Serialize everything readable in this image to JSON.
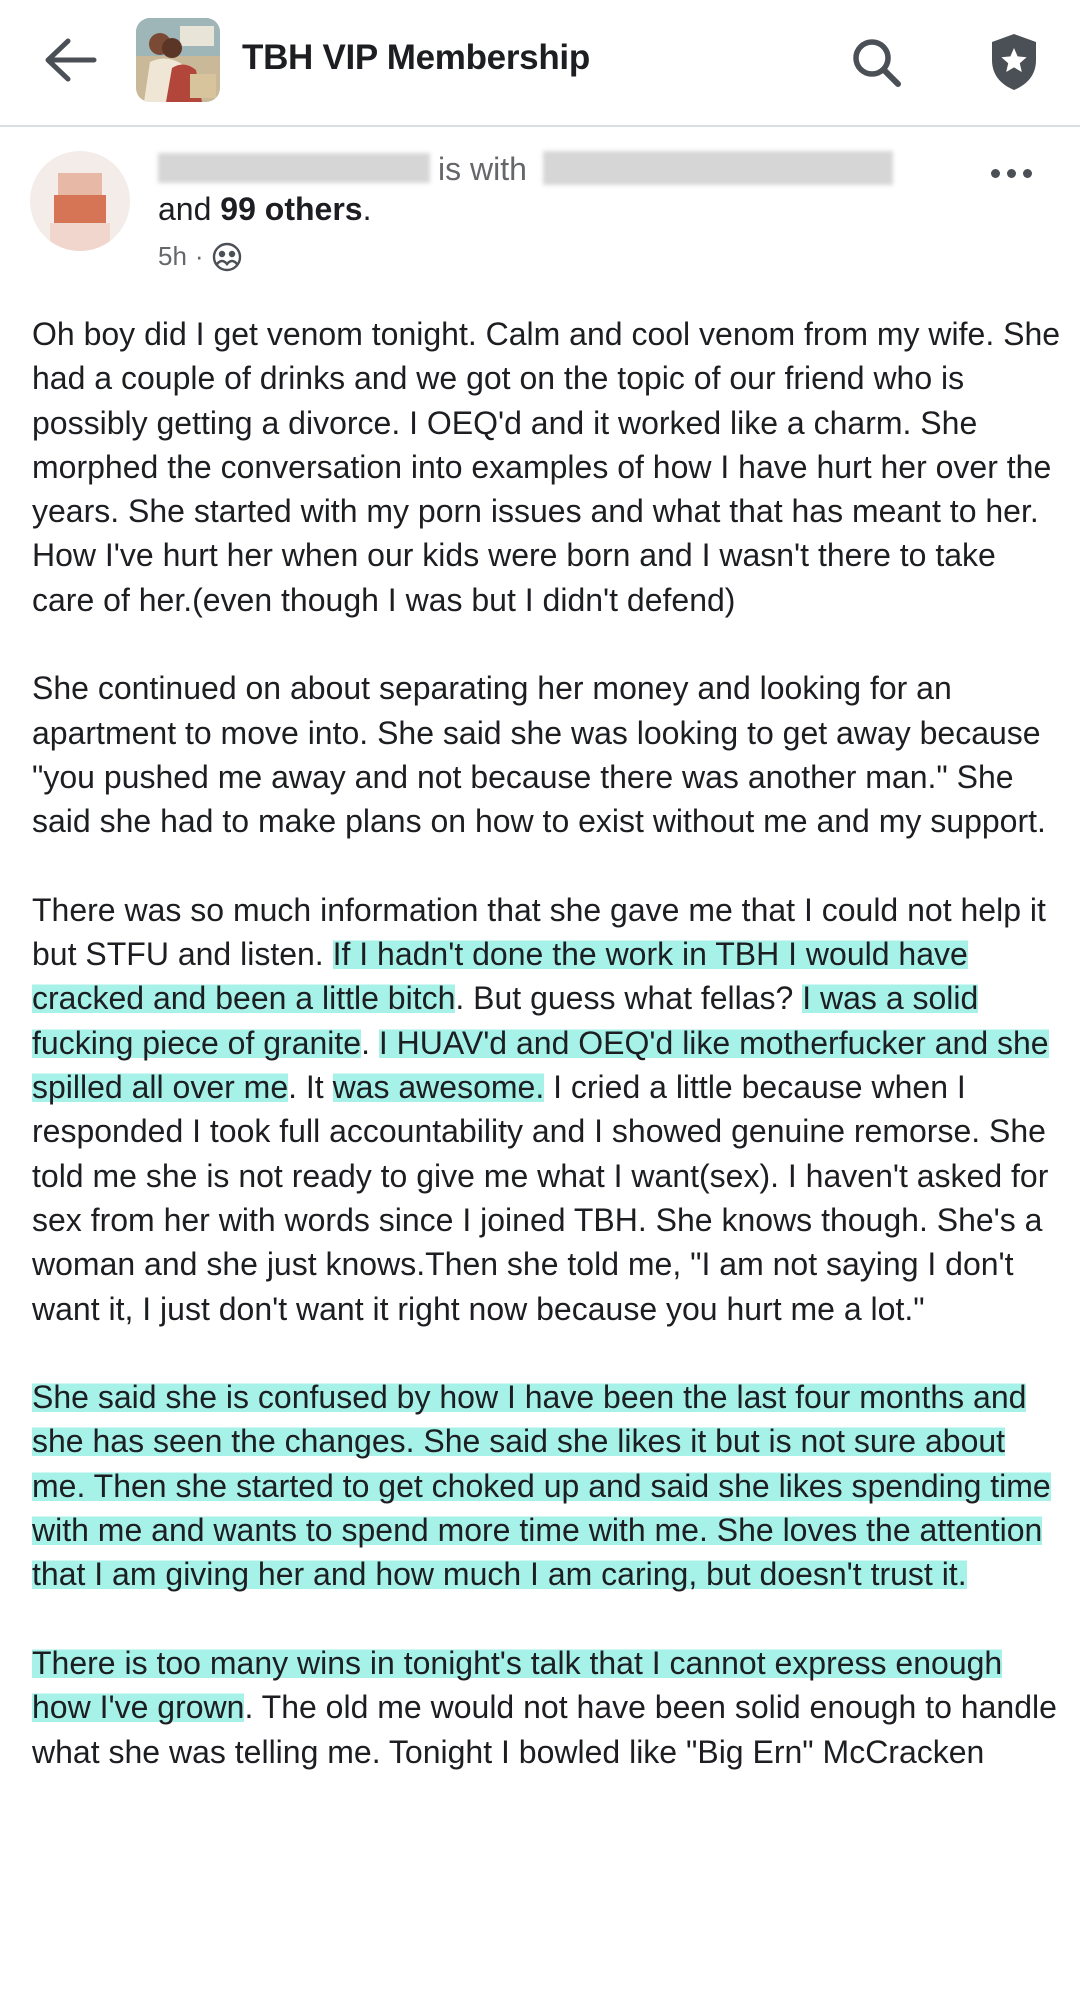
{
  "header": {
    "back_icon": "arrow-left-icon",
    "group_title": "TBH VIP Membership",
    "search_icon": "search-icon",
    "shield_icon": "shield-star-icon"
  },
  "post": {
    "author_connector": "is with",
    "others_prefix": "and",
    "others_count": "99 others",
    "others_suffix": ".",
    "timestamp": "5h",
    "meta_separator": "·",
    "privacy_icon": "group-privacy-icon",
    "more_icon": "more-options-icon",
    "paragraphs": [
      [
        {
          "t": "Oh boy did I get venom tonight. Calm and cool venom from my wife. She had a couple of drinks and we got on the topic of our friend who is possibly getting a divorce.  I OEQ'd and it worked like a charm. She morphed the conversation into examples of how I have hurt her over the years. She started with my porn issues and what that has meant to her. How I've hurt her when our kids were born and I wasn't there to take care of her.(even though I was but I didn't defend)",
          "h": false
        }
      ],
      [
        {
          "t": "She continued on about separating her money and looking for an apartment to move into. She said she was looking to get away because \"you pushed me away and not because there was another man.\" She said she had to make plans on how to exist without me and my support.",
          "h": false
        }
      ],
      [
        {
          "t": "There was so much information that she gave me that I could not help it but STFU and listen.  ",
          "h": false
        },
        {
          "t": "If I hadn't done the work in TBH I would have cracked and been a little bitch",
          "h": true
        },
        {
          "t": ".  But guess what fellas? ",
          "h": false
        },
        {
          "t": "I was a solid fucking piece of granite",
          "h": true
        },
        {
          "t": ". ",
          "h": false
        },
        {
          "t": "I HUAV'd and OEQ'd like motherfucker and she spilled all over me",
          "h": true
        },
        {
          "t": ". It ",
          "h": false
        },
        {
          "t": "was awesome.",
          "h": true
        },
        {
          "t": " I cried a little because when I responded I took full accountability and I showed genuine remorse. She told me she is not ready to give me what I want(sex). I haven't asked for sex from her with words since I joined TBH. She knows though. She's a woman and she just knows.Then she told me, \"I am not saying I don't want it, I just don't want it right now because you hurt me a lot.\"",
          "h": false
        }
      ],
      [
        {
          "t": "She said she is confused by how I have been the last four months and she has seen the changes. She said she likes it but is not sure about me.  Then she started to get choked up and said she likes spending time with me and wants to spend more time with me. She loves the attention that I am giving her and how much I am caring, but doesn't trust it.",
          "h": true
        }
      ],
      [
        {
          "t": "There is too many wins in tonight's talk that I cannot express enough how I've grown",
          "h": true
        },
        {
          "t": ". The old me would not have been solid enough to handle what she was telling me.  Tonight I bowled like \"Big Ern\" McCracken",
          "h": false
        }
      ]
    ]
  },
  "colors": {
    "highlight": "#5ce6d6",
    "text": "#1c1e21",
    "secondary_text": "#65676b"
  }
}
